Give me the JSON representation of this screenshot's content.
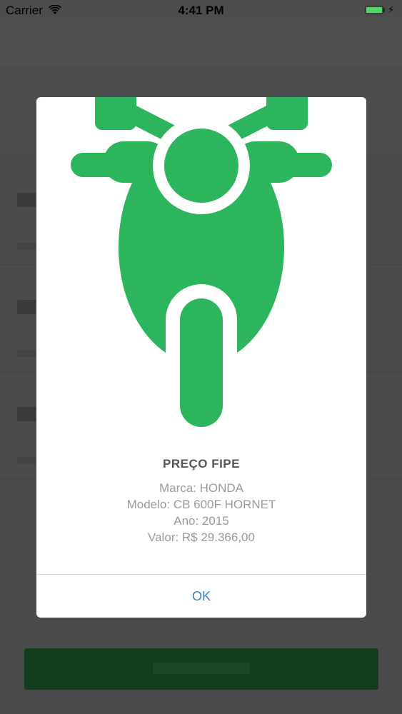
{
  "status_bar": {
    "carrier": "Carrier",
    "time": "4:41 PM",
    "battery_level": 1.0,
    "charging_icon": "bolt-icon"
  },
  "alert": {
    "icon": "motorcycle-icon",
    "icon_color": "#2db55d",
    "title": "PREÇO FIPE",
    "lines": {
      "marca": "Marca: HONDA",
      "modelo": "Modelo: CB 600F HORNET",
      "ano": "Ano: 2015",
      "valor": "Valor: R$ 29.366,00"
    },
    "ok_label": "OK",
    "ok_color": "#3b84c9"
  },
  "colors": {
    "dim_overlay": "#4d4d4d",
    "background_button": "#133e1e"
  }
}
